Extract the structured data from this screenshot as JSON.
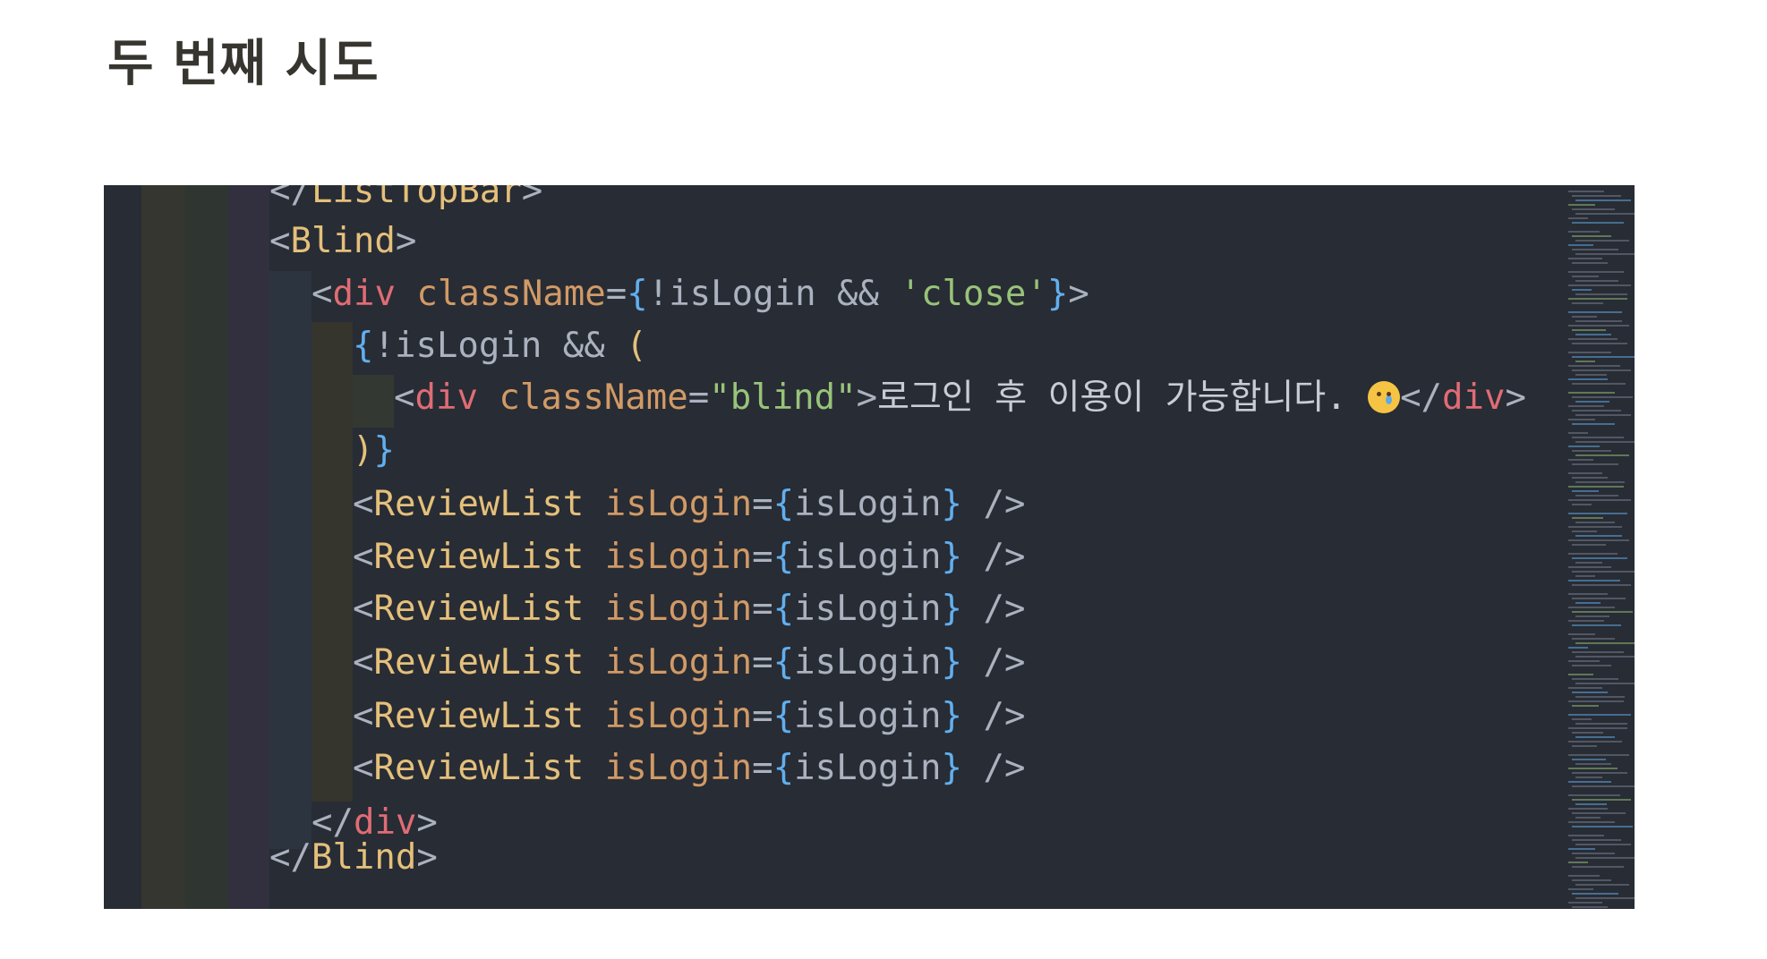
{
  "heading": "두 번째 시도",
  "code": {
    "line0": {
      "open": "</",
      "name": "ListTopBar",
      "close": ">"
    },
    "line1": {
      "open": "<",
      "name": "Blind",
      "close": ">"
    },
    "line2": {
      "open": "<",
      "tag": "div",
      "attr": "className",
      "eq": "=",
      "brace_open": "{",
      "expr": "!isLogin && ",
      "str": "'close'",
      "brace_close": "}",
      "close": ">"
    },
    "line3": {
      "brace_open": "{",
      "expr": "!isLogin && ",
      "paren_open": "("
    },
    "line4": {
      "open": "<",
      "tag": "div",
      "attr": "className",
      "eq": "=",
      "str": "\"blind\"",
      "gt": ">",
      "text": "로그인 후 이용이 가능합니다. ",
      "end_open": "</",
      "end_tag": "div",
      "end_close": ">"
    },
    "line5": {
      "paren_close": ")",
      "brace_close": "}"
    },
    "review_lines": [
      {
        "open": "<",
        "name": "ReviewList",
        "attr": "isLogin",
        "eq": "=",
        "brace_open": "{",
        "value": "isLogin",
        "brace_close": "}",
        "close": " />"
      },
      {
        "open": "<",
        "name": "ReviewList",
        "attr": "isLogin",
        "eq": "=",
        "brace_open": "{",
        "value": "isLogin",
        "brace_close": "}",
        "close": " />"
      },
      {
        "open": "<",
        "name": "ReviewList",
        "attr": "isLogin",
        "eq": "=",
        "brace_open": "{",
        "value": "isLogin",
        "brace_close": "}",
        "close": " />"
      },
      {
        "open": "<",
        "name": "ReviewList",
        "attr": "isLogin",
        "eq": "=",
        "brace_open": "{",
        "value": "isLogin",
        "brace_close": "}",
        "close": " />"
      },
      {
        "open": "<",
        "name": "ReviewList",
        "attr": "isLogin",
        "eq": "=",
        "brace_open": "{",
        "value": "isLogin",
        "brace_close": "}",
        "close": " />"
      },
      {
        "open": "<",
        "name": "ReviewList",
        "attr": "isLogin",
        "eq": "=",
        "brace_open": "{",
        "value": "isLogin",
        "brace_close": "}",
        "close": " />"
      }
    ],
    "line12": {
      "open": "</",
      "tag": "div",
      "close": ">"
    },
    "line13": {
      "open": "</",
      "name": "Blind",
      "close": ">"
    }
  },
  "emoji_icon": "crying-face-emoji",
  "colors": {
    "editor_bg": "#282c34",
    "tag": "#e06c75",
    "component": "#e5c07b",
    "attribute": "#d19a66",
    "string": "#98c379",
    "brace": "#61afef",
    "punctuation": "#abb2bf",
    "heading": "#37352f"
  }
}
